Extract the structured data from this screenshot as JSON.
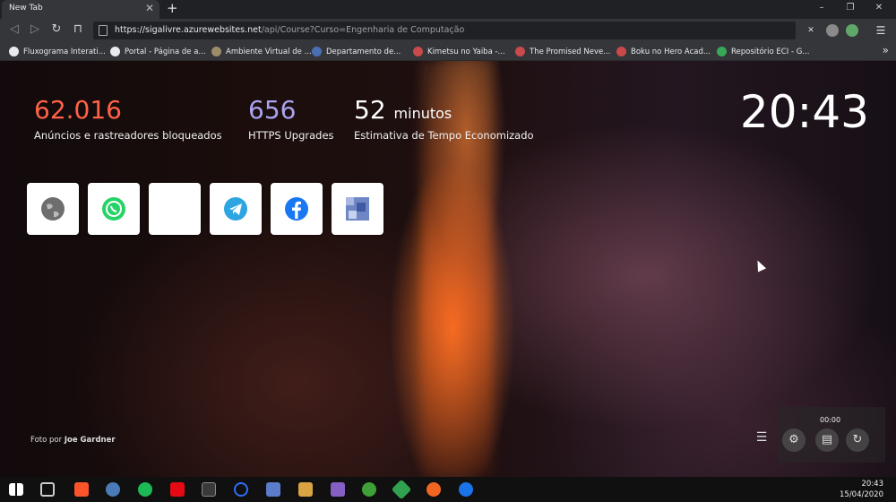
{
  "browser": {
    "tab_title": "New Tab",
    "tab_close": "✕",
    "new_tab": "+",
    "window_minimize": "–",
    "window_restore": "❐",
    "window_close": "✕",
    "url_host": "https://sigalivre.azurewebsites.net",
    "url_path": "/api/Course?Curso=Engenharia de Computação",
    "menu": "☰"
  },
  "bookmarks": [
    {
      "label": "Fluxograma Interati...",
      "color": "#e8eaed"
    },
    {
      "label": "Portal - Página de a...",
      "color": "#e8eaed"
    },
    {
      "label": "Ambiente Virtual de ...",
      "color": "#9d8c6a"
    },
    {
      "label": "Departamento de...",
      "color": "#4b6fb4"
    },
    {
      "label": "Kimetsu no Yaiba -...",
      "color": "#c94a4a"
    },
    {
      "label": "The Promised Neve...",
      "color": "#c94a4a"
    },
    {
      "label": "Boku no Hero Acad...",
      "color": "#c94a4a"
    },
    {
      "label": "Repositório ECI - G...",
      "color": "#3aa757"
    }
  ],
  "bookmarks_more": "»",
  "stats": {
    "ads_count": "62.016",
    "ads_label": "Anúncios e rastreadores bloqueados",
    "ads_color": "#ff6347",
    "https_count": "656",
    "https_label": "HTTPS Upgrades",
    "https_color": "#a9a3f0",
    "time_count": "52",
    "time_unit": "minutos",
    "time_label": "Estimativa de Tempo Economizado"
  },
  "clock": "20:43",
  "top_sites": [
    {
      "name": "globe-icon",
      "color": "#6e6e6e"
    },
    {
      "name": "whatsapp-icon",
      "color": "#25d366"
    },
    {
      "name": "blank-site-icon",
      "color": "#ffffff"
    },
    {
      "name": "telegram-icon",
      "color": "#2ca5e0"
    },
    {
      "name": "facebook-icon",
      "color": "#1877f2"
    },
    {
      "name": "image-site-icon",
      "color": "#6f86c4"
    }
  ],
  "credit": {
    "prefix": "Foto por ",
    "author": "Joe Gardner"
  },
  "recorder": {
    "time": "00:00"
  },
  "taskbar": {
    "time": "20:43",
    "date": "15/04/2020"
  }
}
